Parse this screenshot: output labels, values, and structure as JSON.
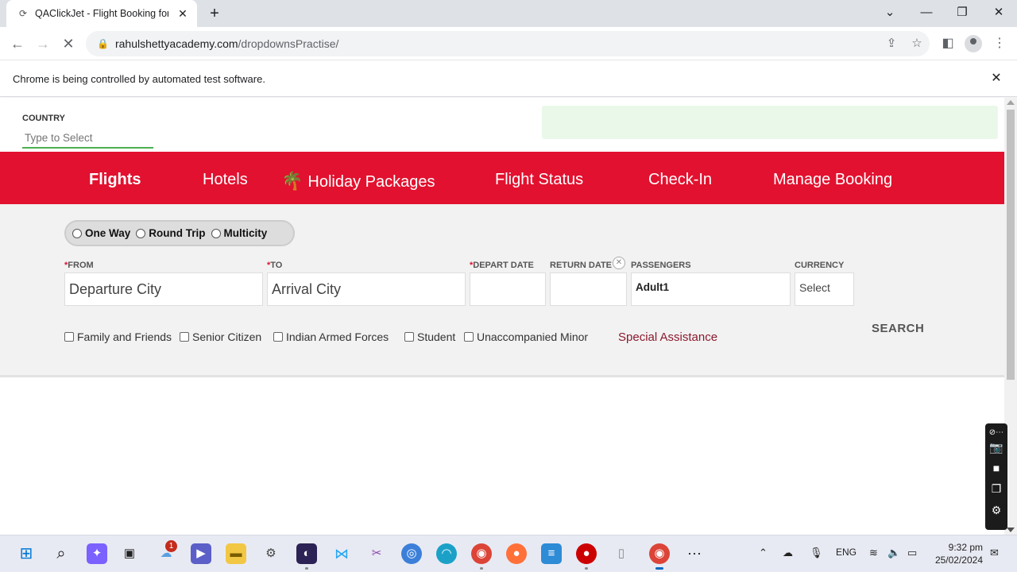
{
  "browser": {
    "tab_title": "QAClickJet - Flight Booking for Domestic and International, Cheap Air Tickets",
    "url_domain": "rahulshettyacademy.com",
    "url_path": "/dropdownsPractise/",
    "automation_notice": "Chrome is being controlled by automated test software."
  },
  "page": {
    "country_label": "COUNTRY",
    "country_placeholder": "Type to Select",
    "nav": [
      {
        "label": "Flights",
        "active": true
      },
      {
        "label": "Hotels"
      },
      {
        "label": "Holiday Packages"
      },
      {
        "label": "Flight Status"
      },
      {
        "label": "Check-In"
      },
      {
        "label": "Manage Booking"
      }
    ],
    "trip_types": [
      "One Way",
      "Round Trip",
      "Multicity"
    ],
    "fields": {
      "from_label": "FROM",
      "from_placeholder": "Departure City",
      "to_label": "TO",
      "to_placeholder": "Arrival City",
      "depart_label": "DEPART DATE",
      "return_label": "RETURN DATE",
      "passengers_label": "PASSENGERS",
      "passengers_value": "Adult1",
      "currency_label": "CURRENCY",
      "currency_value": "Select"
    },
    "required_mark": "*",
    "checkboxes": [
      "Family and Friends",
      "Senior Citizen",
      "Indian Armed Forces",
      "Student",
      "Unaccompanied Minor"
    ],
    "special_assistance": "Special Assistance",
    "search_label": "SEARCH"
  },
  "taskbar": {
    "notification_count": "1",
    "language": "ENG",
    "time": "9:32 pm",
    "date": "25/02/2024"
  },
  "colors": {
    "brand_red": "#e2112f",
    "gray_panel": "#f2f2f2",
    "special_link": "#8b1a2e"
  }
}
